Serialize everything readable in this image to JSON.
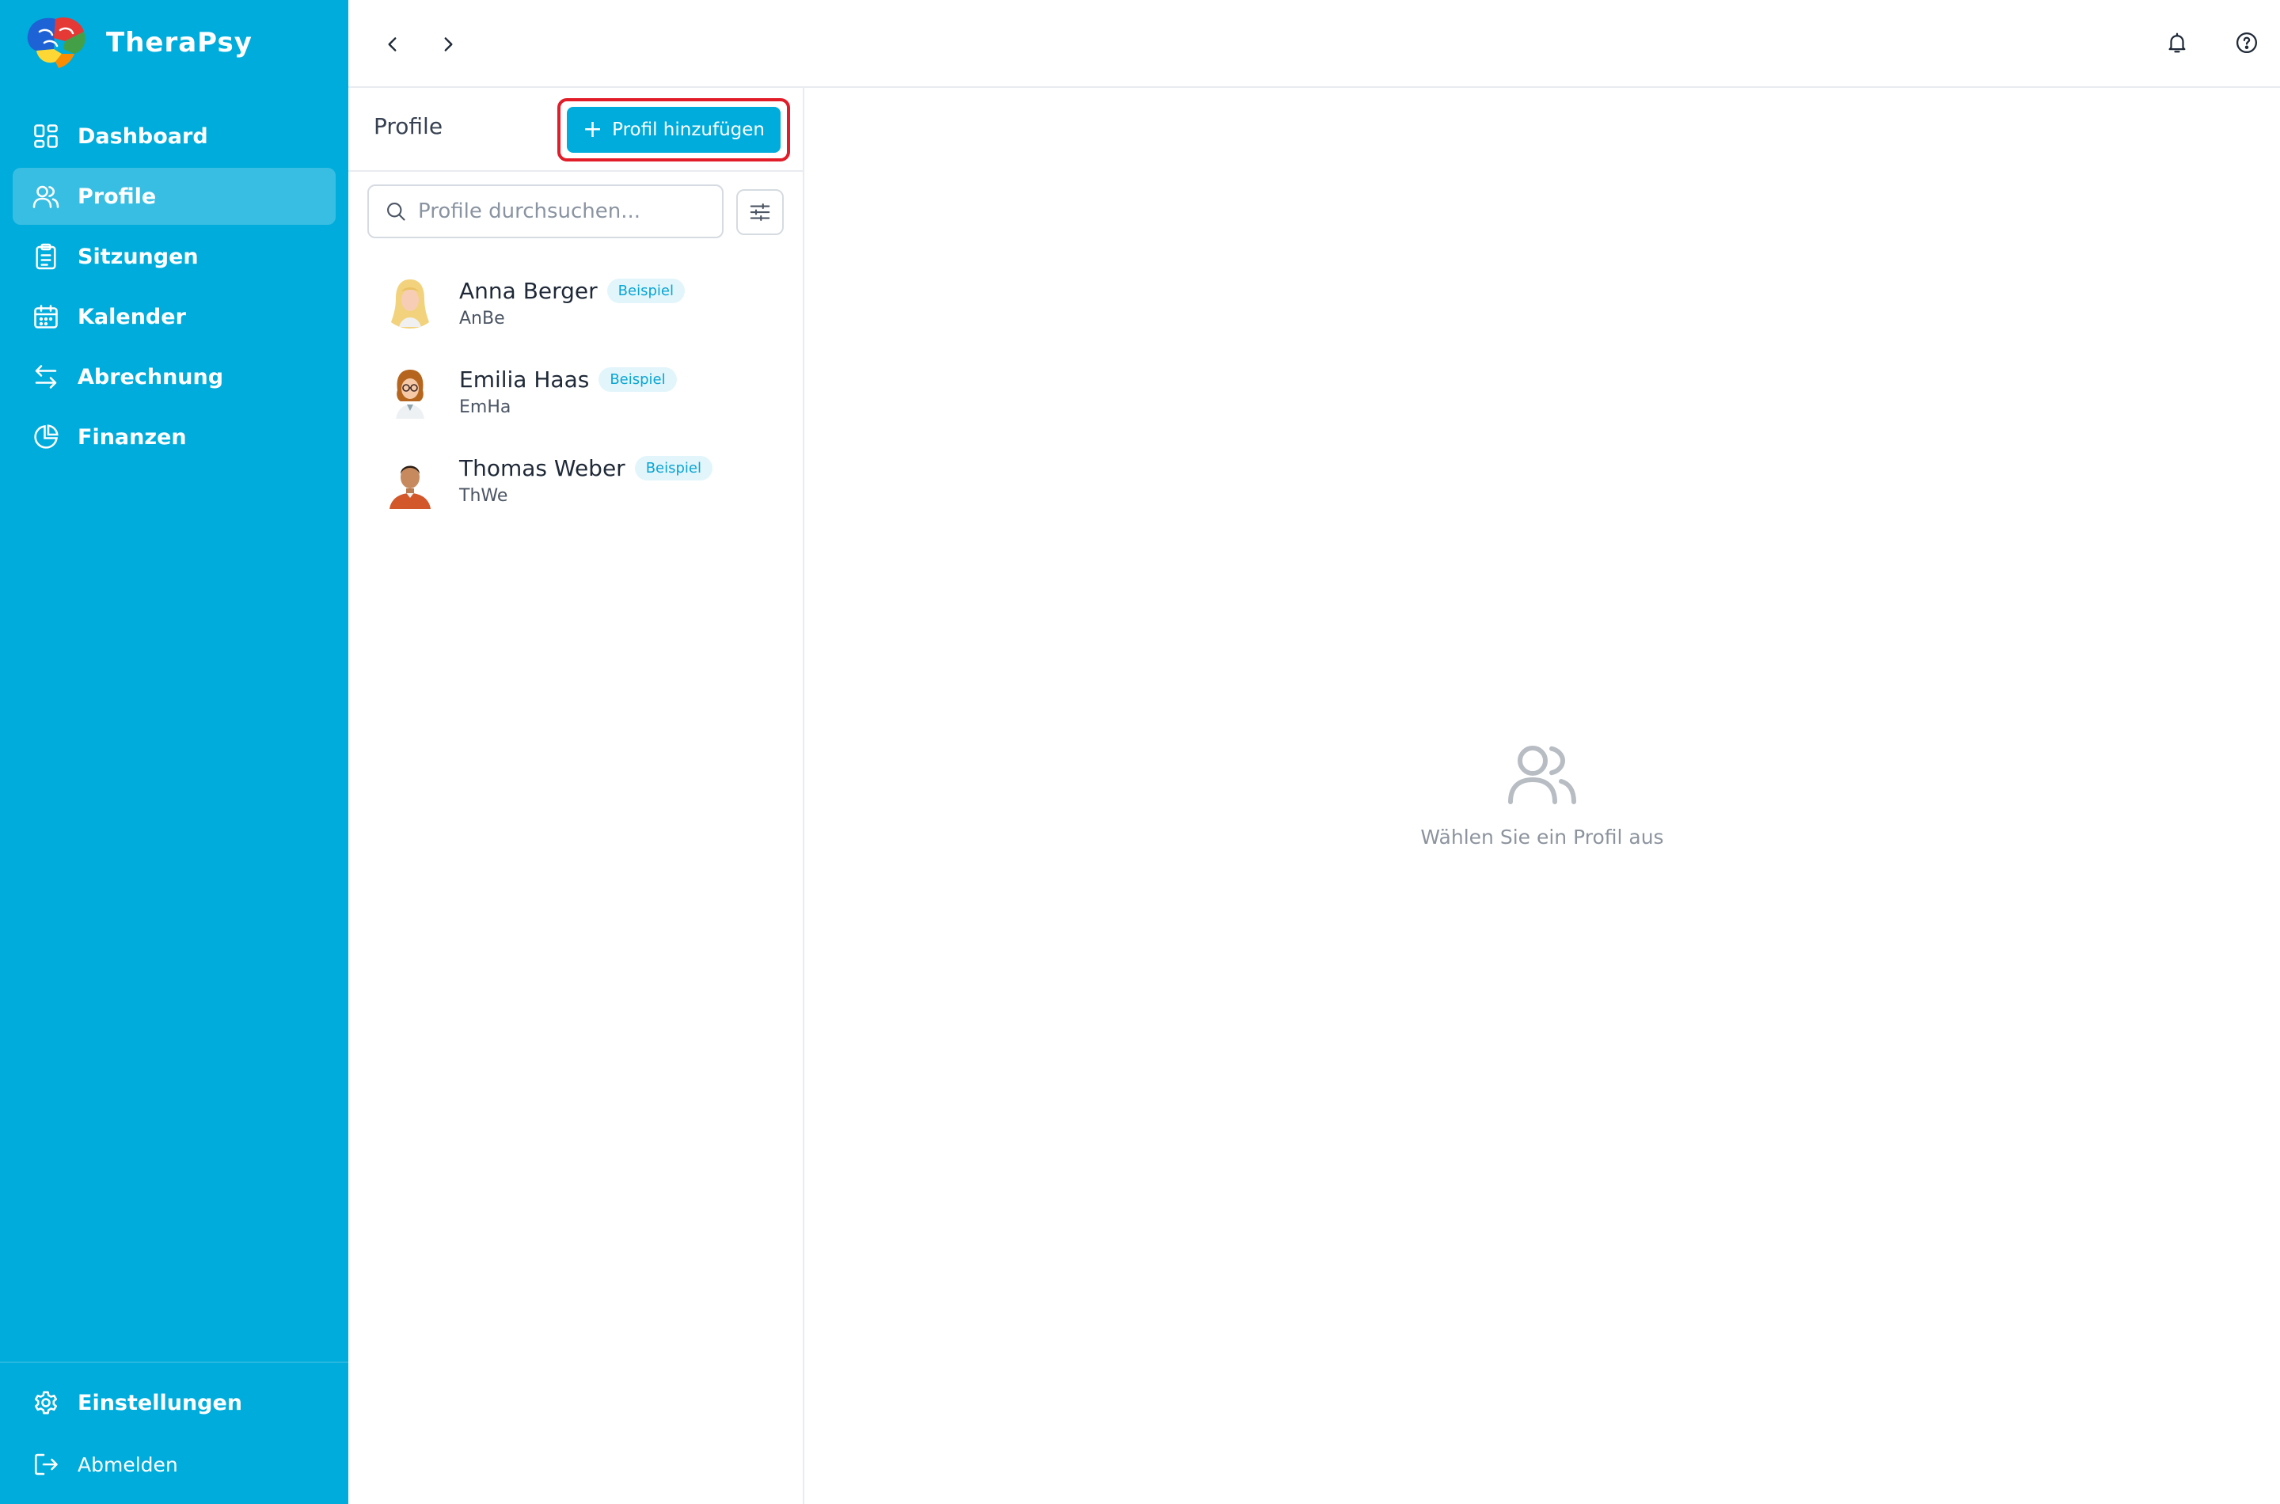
{
  "app": {
    "name": "TheraPsy"
  },
  "sidebar": {
    "items": [
      {
        "label": "Dashboard",
        "icon": "dashboard-icon",
        "active": false
      },
      {
        "label": "Profile",
        "icon": "users-icon",
        "active": true
      },
      {
        "label": "Sitzungen",
        "icon": "clipboard-icon",
        "active": false
      },
      {
        "label": "Kalender",
        "icon": "calendar-icon",
        "active": false
      },
      {
        "label": "Abrechnung",
        "icon": "arrows-exchange-icon",
        "active": false
      },
      {
        "label": "Finanzen",
        "icon": "pie-chart-icon",
        "active": false
      }
    ],
    "bottom": [
      {
        "label": "Einstellungen",
        "icon": "gear-icon"
      },
      {
        "label": "Abmelden",
        "icon": "logout-icon"
      }
    ]
  },
  "topbar": {
    "back_icon": "chevron-left-icon",
    "forward_icon": "chevron-right-icon",
    "notification_icon": "bell-icon",
    "help_icon": "help-circle-icon"
  },
  "profiles_panel": {
    "title": "Profile",
    "add_button": {
      "plus": "+",
      "label": "Profil hinzufügen"
    },
    "search": {
      "placeholder": "Profile durchsuchen...",
      "value": ""
    },
    "filter_icon": "sliders-icon",
    "items": [
      {
        "name": "Anna Berger",
        "badge": "Beispiel",
        "short": "AnBe",
        "avatar": "avatar-blonde-woman-icon"
      },
      {
        "name": "Emilia Haas",
        "badge": "Beispiel",
        "short": "EmHa",
        "avatar": "avatar-woman-glasses-icon"
      },
      {
        "name": "Thomas Weber",
        "badge": "Beispiel",
        "short": "ThWe",
        "avatar": "avatar-man-icon"
      }
    ]
  },
  "detail": {
    "empty_icon": "users-icon",
    "empty_text": "Wählen Sie ein Profil aus"
  },
  "colors": {
    "brand": "#00acdb",
    "highlight": "#e11d2a",
    "badge_bg": "#e2f5fb",
    "badge_text": "#0aa5d3"
  }
}
